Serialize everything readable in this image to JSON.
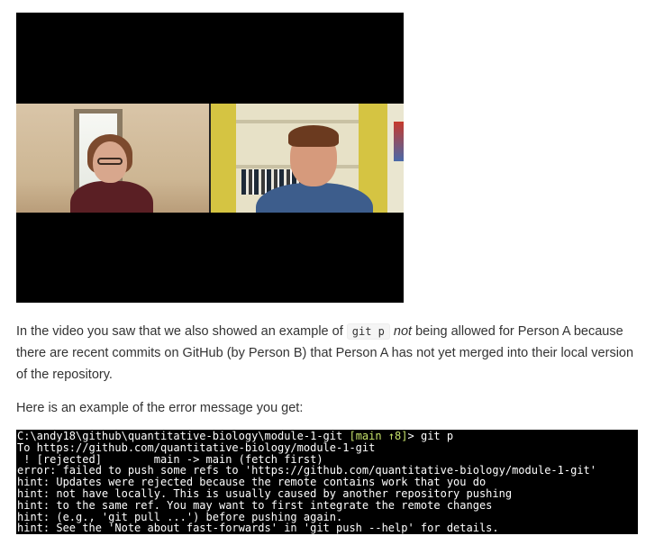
{
  "video": {
    "label": "Video call recording: Person A and Person B"
  },
  "intro_paragraph": {
    "text_before_code": "In the video you saw that we also showed an example of ",
    "code": "git p",
    "emphasis": "not",
    "text_after_emphasis": " being allowed for Person A because there are recent commits on GitHub (by Person B) that Person A has not yet merged into their local version of the repository."
  },
  "example_paragraph": {
    "text": "Here is an example of the error message you get:"
  },
  "terminal": {
    "colors": {
      "background": "#000000",
      "text": "#ffffff",
      "branch": "#c6e36b"
    },
    "prompt_path": "C:\\andy18\\github\\quantitative-biology\\module-1-git",
    "prompt_branch": "[main ↑8]",
    "prompt_symbol": ">",
    "command": "git p",
    "lines": [
      "To https://github.com/quantitative-biology/module-1-git",
      " ! [rejected]        main -> main (fetch first)",
      "error: failed to push some refs to 'https://github.com/quantitative-biology/module-1-git'",
      "hint: Updates were rejected because the remote contains work that you do",
      "hint: not have locally. This is usually caused by another repository pushing",
      "hint: to the same ref. You may want to first integrate the remote changes",
      "hint: (e.g., 'git pull ...') before pushing again.",
      "hint: See the 'Note about fast-forwards' in 'git push --help' for details."
    ]
  }
}
